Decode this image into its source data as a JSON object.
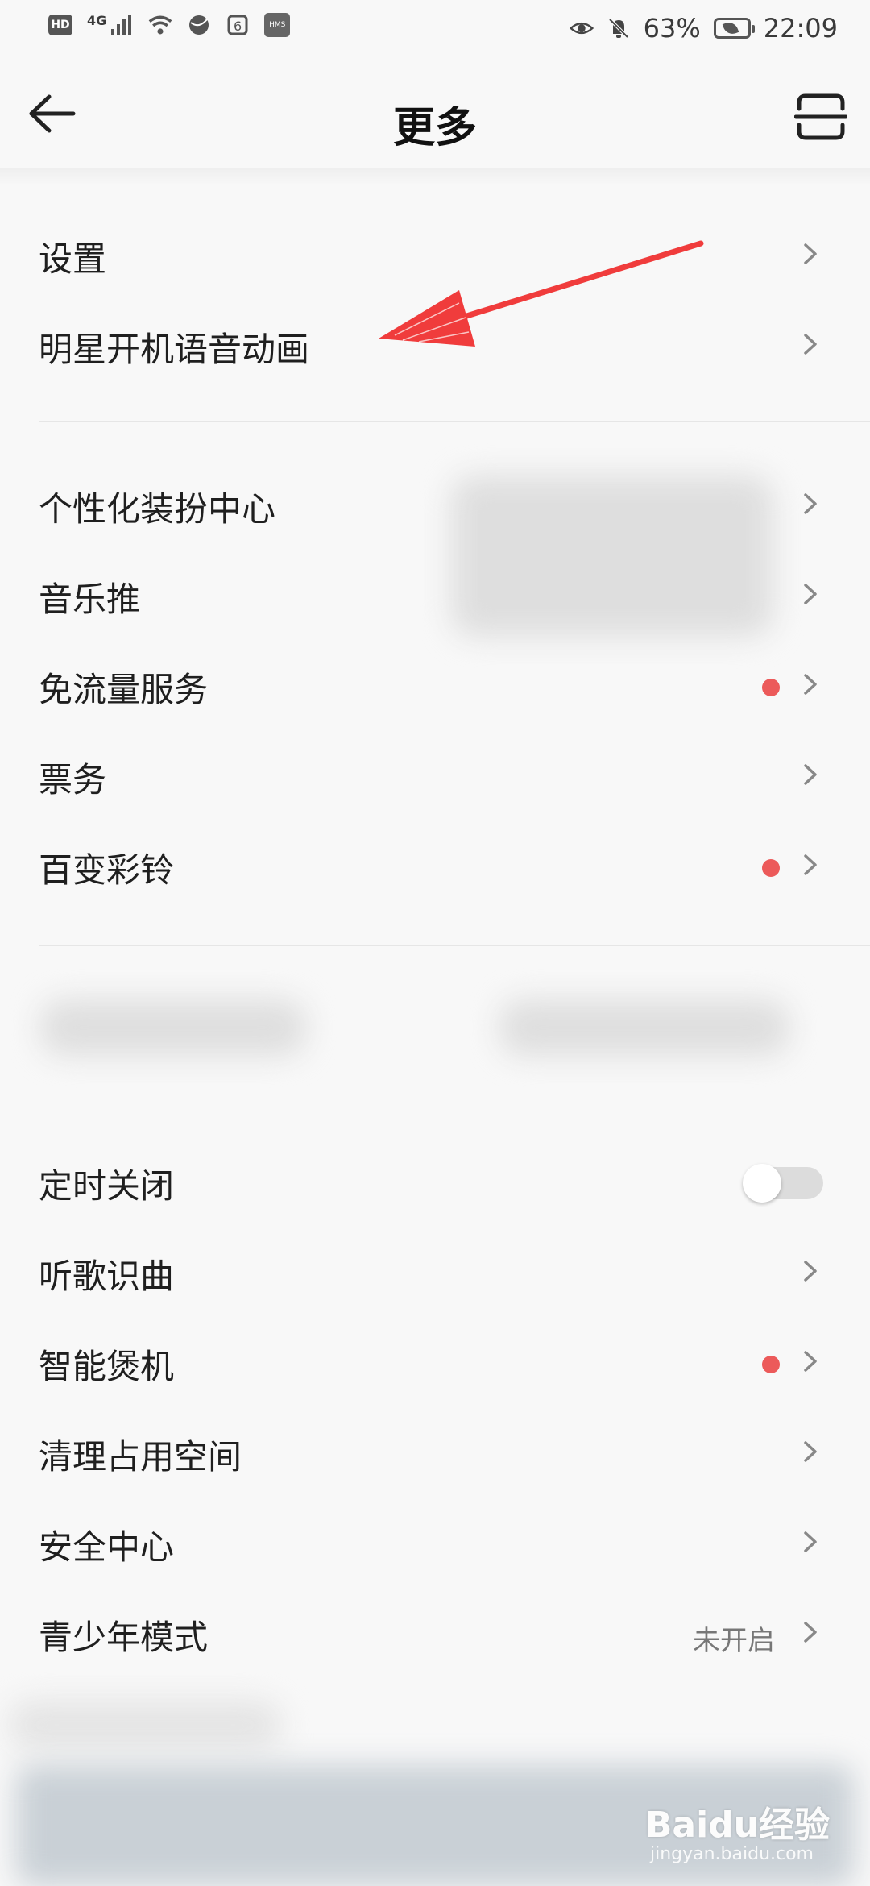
{
  "status_bar": {
    "hd": "HD",
    "network": "4G",
    "hms": "HMS",
    "battery": "63%",
    "time": "22:09"
  },
  "header": {
    "title": "更多",
    "back_icon": "arrow-left-icon",
    "scan_icon": "scan-icon"
  },
  "section1": [
    {
      "label": "设置"
    },
    {
      "label": "明星开机语音动画"
    }
  ],
  "section2": [
    {
      "label": "个性化装扮中心"
    },
    {
      "label": "音乐推"
    },
    {
      "label": "免流量服务",
      "dot": true
    },
    {
      "label": "票务"
    },
    {
      "label": "百变彩铃",
      "dot": true
    }
  ],
  "section3": [
    {
      "label": "定时关闭",
      "toggle": false
    },
    {
      "label": "听歌识曲"
    },
    {
      "label": "智能煲机",
      "dot": true
    },
    {
      "label": "清理占用空间"
    },
    {
      "label": "安全中心"
    },
    {
      "label": "青少年模式",
      "value": "未开启"
    }
  ],
  "colors": {
    "accent_dot": "#ec5a5a",
    "annotation_arrow": "#f03c3c",
    "background": "#f8f8f8"
  },
  "watermark": {
    "brand": "Baidu经验",
    "site": "jingyan.baidu.com"
  }
}
